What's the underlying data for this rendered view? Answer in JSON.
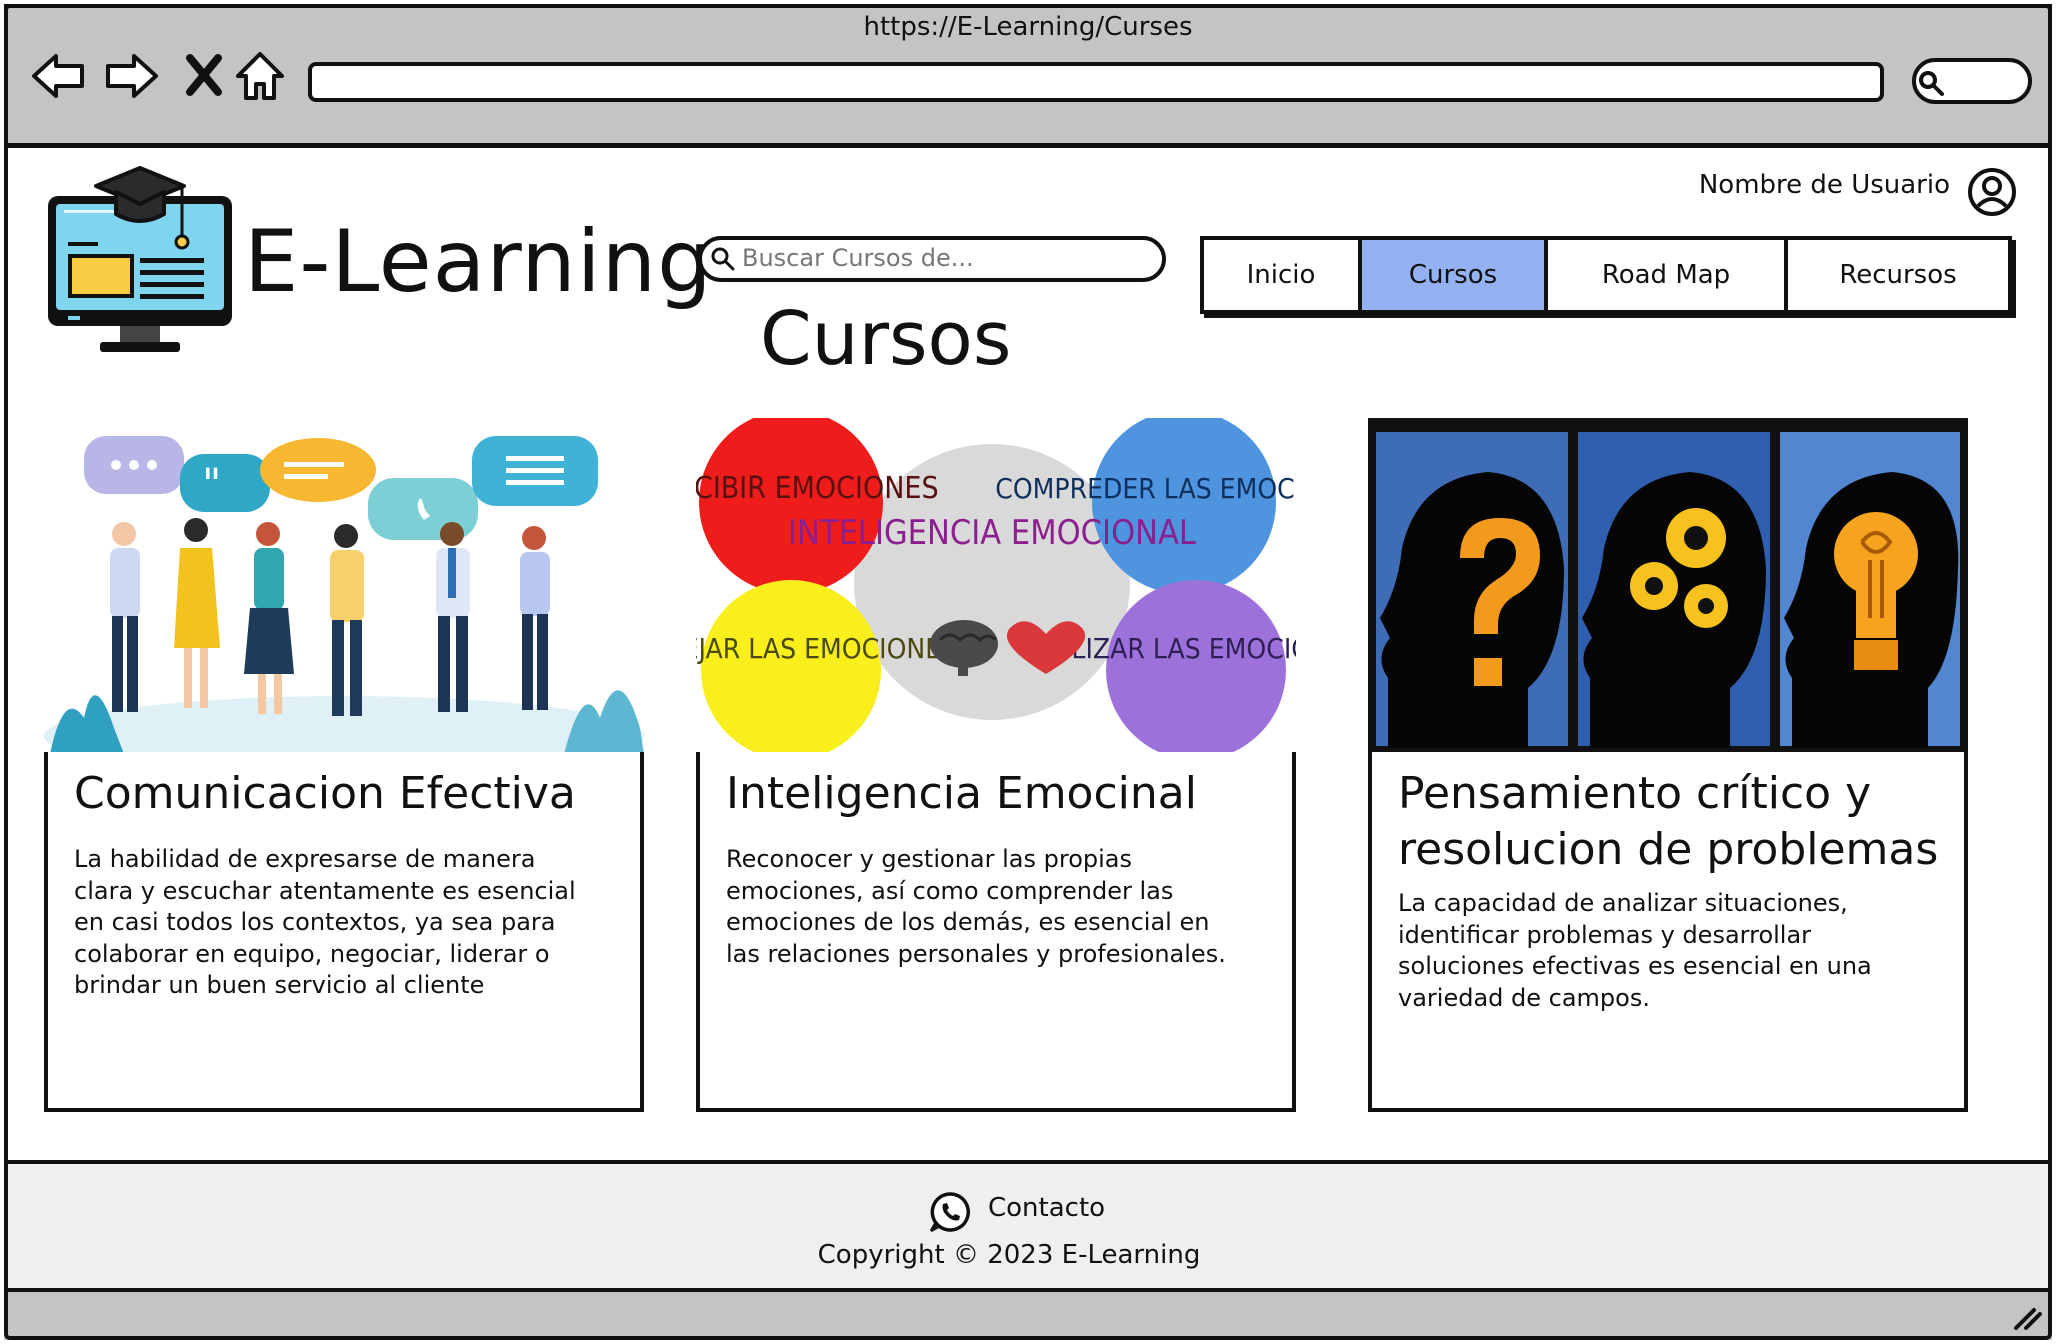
{
  "browser": {
    "url": "https://E-Learning/Curses"
  },
  "header": {
    "brand": "E-Learning",
    "search_placeholder": "Buscar Cursos de...",
    "username": "Nombre de Usuario"
  },
  "nav": {
    "tabs": [
      "Inicio",
      "Cursos",
      "Road Map",
      "Recursos"
    ],
    "active": "Cursos"
  },
  "page": {
    "title": "Cursos"
  },
  "courses": [
    {
      "title": "Comunicacion Efectiva",
      "description": "La habilidad de expresarse de manera clara y escuchar atentamente es esencial en casi todos los contextos, ya sea para colaborar en equipo, negociar, liderar o brindar un buen servicio al cliente"
    },
    {
      "title": "Inteligencia Emocinal",
      "description": "Reconocer y gestionar las propias emociones, así como comprender las emociones de los demás, es esencial en las relaciones personales y profesionales.",
      "image_labels": {
        "center": "INTELIGENCIA EMOCIONAL",
        "top_left": "PERCIBIR EMOCIONES",
        "top_right": "COMPREDER LAS EMOCIONES",
        "bottom_left": "MANEJAR LAS EMOCIONES",
        "bottom_right": "UTILIZAR LAS EMOCIONES"
      }
    },
    {
      "title": "Pensamiento crítico y resolucion de problemas",
      "description": "La capacidad de analizar situaciones, identificar problemas y desarrollar soluciones efectivas es esencial en una variedad de campos."
    }
  ],
  "footer": {
    "contact": "Contacto",
    "copyright": "Copyright © 2023 E-Learning"
  },
  "colors": {
    "active_tab": "#94b2f2",
    "chrome": "#c4c4c4",
    "footer": "#efefef"
  }
}
